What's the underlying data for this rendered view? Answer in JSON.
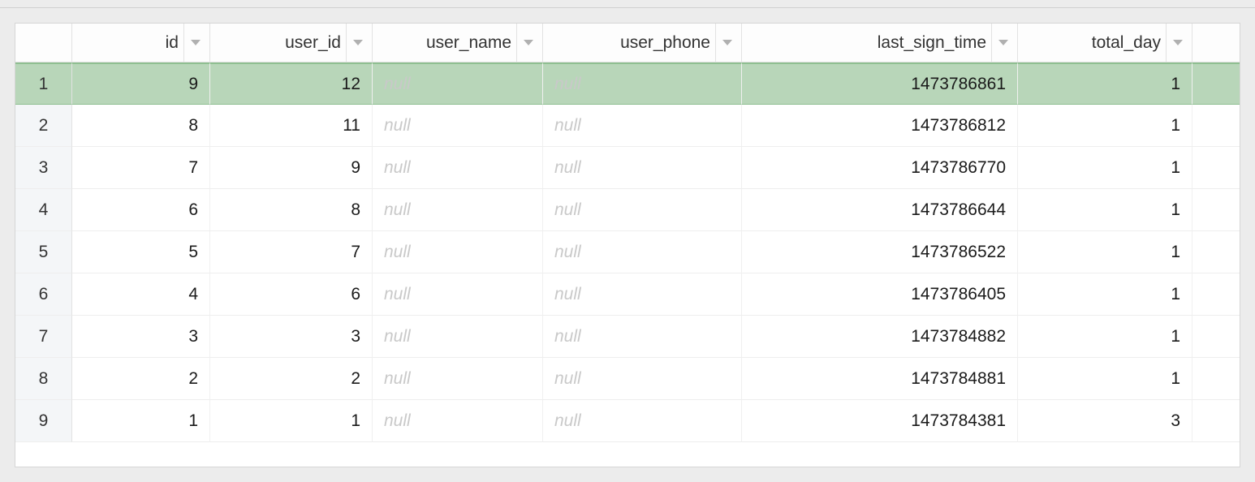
{
  "null_text": "null",
  "columns": [
    {
      "key": "id",
      "label": "id",
      "type": "num"
    },
    {
      "key": "user_id",
      "label": "user_id",
      "type": "num"
    },
    {
      "key": "user_name",
      "label": "user_name",
      "type": "text"
    },
    {
      "key": "user_phone",
      "label": "user_phone",
      "type": "text"
    },
    {
      "key": "last_sign_time",
      "label": "last_sign_time",
      "type": "num"
    },
    {
      "key": "total_day",
      "label": "total_day",
      "type": "num"
    }
  ],
  "rows": [
    {
      "n": 1,
      "selected": true,
      "id": 9,
      "user_id": 12,
      "user_name": null,
      "user_phone": null,
      "last_sign_time": 1473786861,
      "total_day": 1
    },
    {
      "n": 2,
      "selected": false,
      "id": 8,
      "user_id": 11,
      "user_name": null,
      "user_phone": null,
      "last_sign_time": 1473786812,
      "total_day": 1
    },
    {
      "n": 3,
      "selected": false,
      "id": 7,
      "user_id": 9,
      "user_name": null,
      "user_phone": null,
      "last_sign_time": 1473786770,
      "total_day": 1
    },
    {
      "n": 4,
      "selected": false,
      "id": 6,
      "user_id": 8,
      "user_name": null,
      "user_phone": null,
      "last_sign_time": 1473786644,
      "total_day": 1
    },
    {
      "n": 5,
      "selected": false,
      "id": 5,
      "user_id": 7,
      "user_name": null,
      "user_phone": null,
      "last_sign_time": 1473786522,
      "total_day": 1
    },
    {
      "n": 6,
      "selected": false,
      "id": 4,
      "user_id": 6,
      "user_name": null,
      "user_phone": null,
      "last_sign_time": 1473786405,
      "total_day": 1
    },
    {
      "n": 7,
      "selected": false,
      "id": 3,
      "user_id": 3,
      "user_name": null,
      "user_phone": null,
      "last_sign_time": 1473784882,
      "total_day": 1
    },
    {
      "n": 8,
      "selected": false,
      "id": 2,
      "user_id": 2,
      "user_name": null,
      "user_phone": null,
      "last_sign_time": 1473784881,
      "total_day": 1
    },
    {
      "n": 9,
      "selected": false,
      "id": 1,
      "user_id": 1,
      "user_name": null,
      "user_phone": null,
      "last_sign_time": 1473784381,
      "total_day": 3
    }
  ]
}
